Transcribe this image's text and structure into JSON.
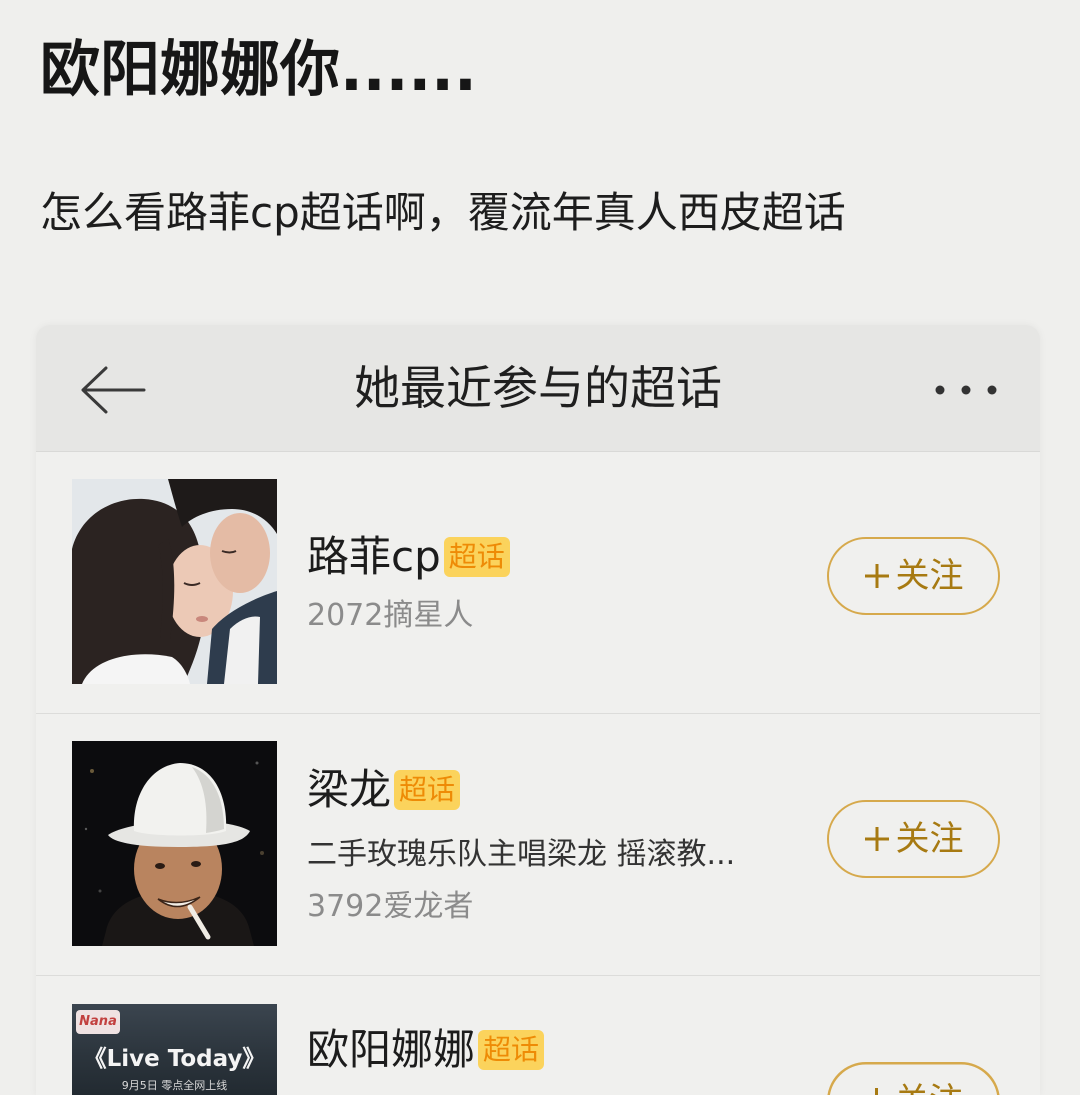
{
  "post": {
    "title": "欧阳娜娜你......",
    "body": "怎么看路菲cp超话啊，覆流年真人西皮超话"
  },
  "topic_page": {
    "header": {
      "title": "她最近参与的超话",
      "back_icon": "arrow-left-icon",
      "more_icon": "more-dots-icon"
    },
    "topics": [
      {
        "name": "路菲cp",
        "badge": "超话",
        "followers": "2072摘星人",
        "follow_icon": "plus-icon",
        "follow_label": "关注"
      },
      {
        "name": "梁龙",
        "badge": "超话",
        "description": "二手玫瑰乐队主唱梁龙 摇滚教...",
        "followers": "3792爱龙者",
        "follow_icon": "plus-icon",
        "follow_label": "关注"
      },
      {
        "name": "欧阳娜娜",
        "badge": "超话",
        "follow_icon": "plus-icon",
        "follow_label": "关注",
        "thumbnail_text": {
          "logo": "Nana",
          "title": "《Live Today》",
          "caption": "9月5日 零点全网上线"
        }
      }
    ]
  },
  "colors": {
    "page_background": "#efefed",
    "header_background": "#e6e6e4",
    "badge_background": "#fbd35c",
    "badge_text": "#ee8b06",
    "follow_border": "#d6a94c",
    "follow_text": "#a77a12",
    "secondary_text": "#8b8b8b"
  }
}
